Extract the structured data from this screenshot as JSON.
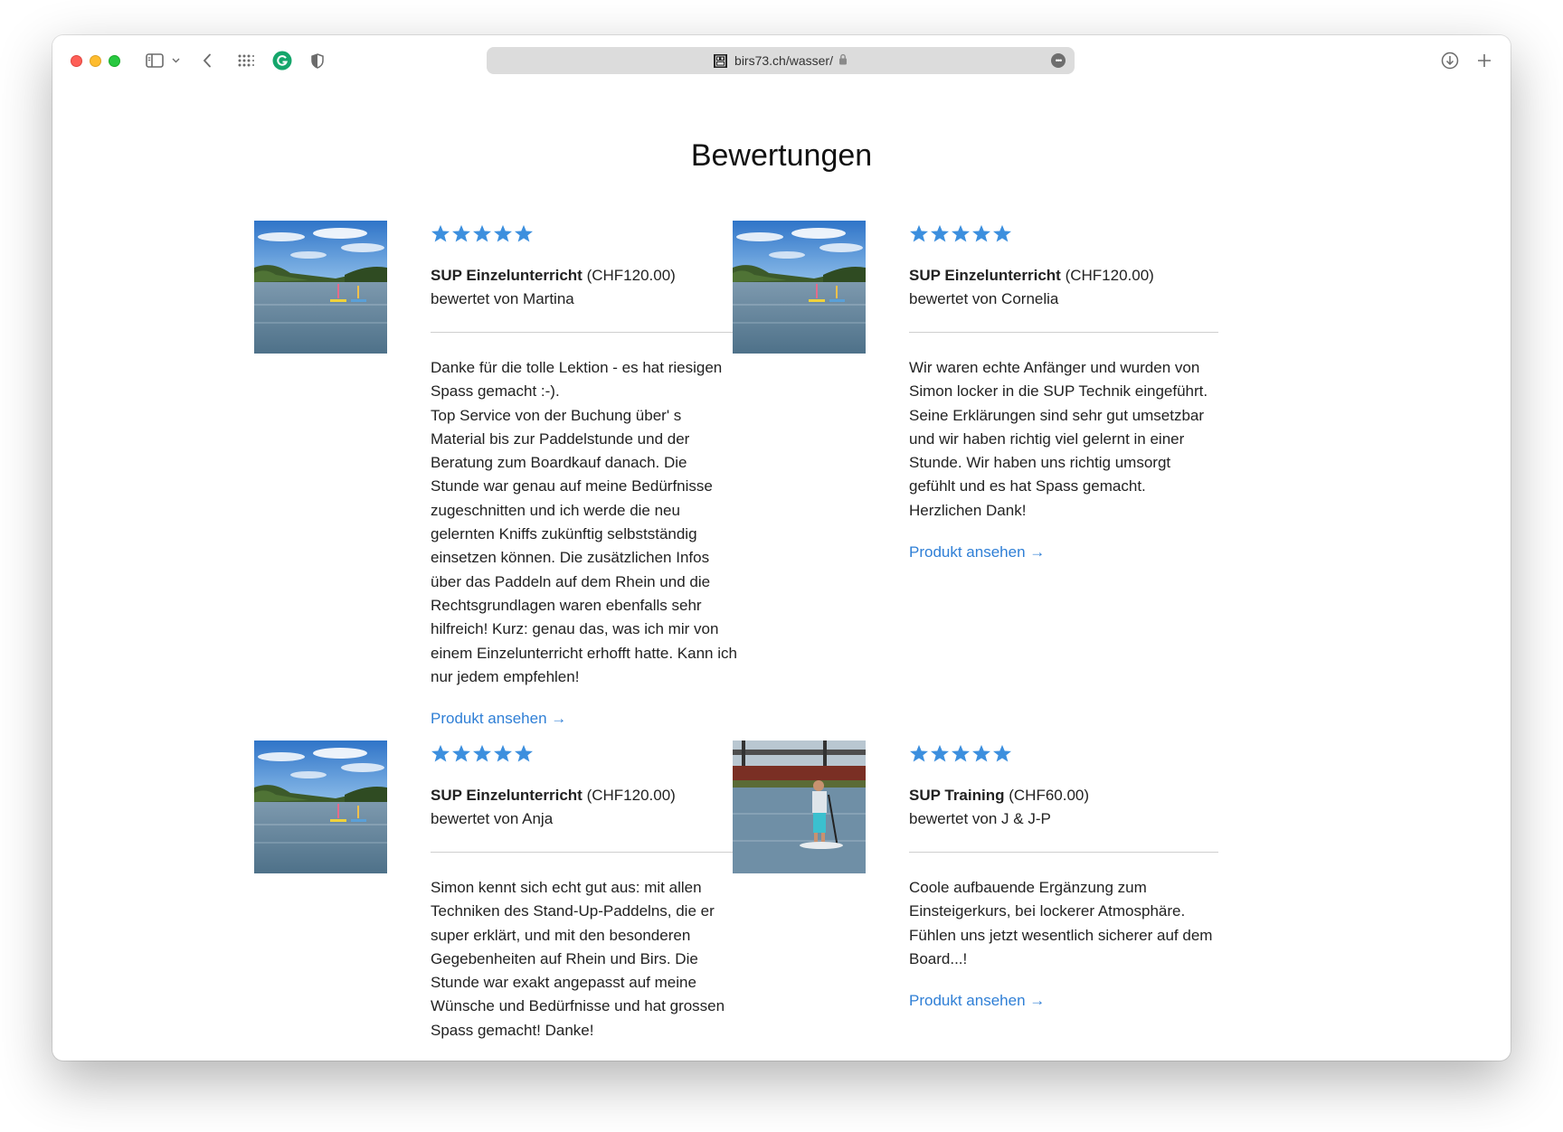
{
  "browser": {
    "url": "birs73.ch/wasser/",
    "favicon_text": "BIR 573"
  },
  "page": {
    "title": "Bewertungen"
  },
  "colors": {
    "star": "#3c8fde",
    "link": "#2f7fd6"
  },
  "reviews": [
    {
      "rating": 5,
      "product_name": "SUP Einzelunterricht",
      "price": "(CHF120.00)",
      "reviewer": "bewertet von Martina",
      "image": "river-paddlers-photo",
      "paragraphs": [
        "Danke für die tolle Lektion - es hat riesigen Spass gemacht :-).",
        "Top Service von der Buchung über' s Material bis zur Paddelstunde und der Beratung zum Boardkauf danach. Die Stunde war genau auf meine Bedürfnisse zugeschnitten und ich werde die neu gelernten Kniffs zukünftig selbstständig einsetzen können. Die zusätzlichen Infos über das Paddeln auf dem Rhein und die Rechtsgrundlagen waren ebenfalls sehr hilfreich! Kurz: genau das, was ich mir von einem Einzelunterricht erhofft hatte. Kann ich nur jedem empfehlen!"
      ],
      "link": "Produkt ansehen →"
    },
    {
      "rating": 5,
      "product_name": "SUP Einzelunterricht",
      "price": "(CHF120.00)",
      "reviewer": "bewertet von Cornelia",
      "image": "river-paddlers-photo",
      "paragraphs": [
        "Wir waren echte Anfänger und wurden von Simon locker in die SUP Technik eingeführt. Seine Erklärungen sind sehr gut umsetzbar und wir haben richtig viel gelernt in einer Stunde. Wir haben uns richtig umsorgt gefühlt und es hat Spass gemacht. Herzlichen Dank!"
      ],
      "link": "Produkt ansehen →"
    },
    {
      "rating": 5,
      "product_name": "SUP Einzelunterricht",
      "price": "(CHF120.00)",
      "reviewer": "bewertet von Anja",
      "image": "river-paddlers-photo",
      "paragraphs": [
        "Simon kennt sich echt gut aus: mit allen Techniken des Stand-Up-Paddelns, die er super erklärt, und mit den besonderen Gegebenheiten auf Rhein und Birs. Die Stunde war exakt angepasst auf meine Wünsche und Bedürfnisse und hat grossen Spass gemacht! Danke!"
      ],
      "link": ""
    },
    {
      "rating": 5,
      "product_name": "SUP Training",
      "price": "(CHF60.00)",
      "reviewer": "bewertet von J & J-P",
      "image": "harbor-paddler-photo",
      "paragraphs": [
        "Coole aufbauende Ergänzung zum Einsteigerkurs, bei lockerer Atmosphäre. Fühlen uns jetzt wesentlich sicherer auf dem Board...!"
      ],
      "link": "Produkt ansehen →"
    }
  ]
}
